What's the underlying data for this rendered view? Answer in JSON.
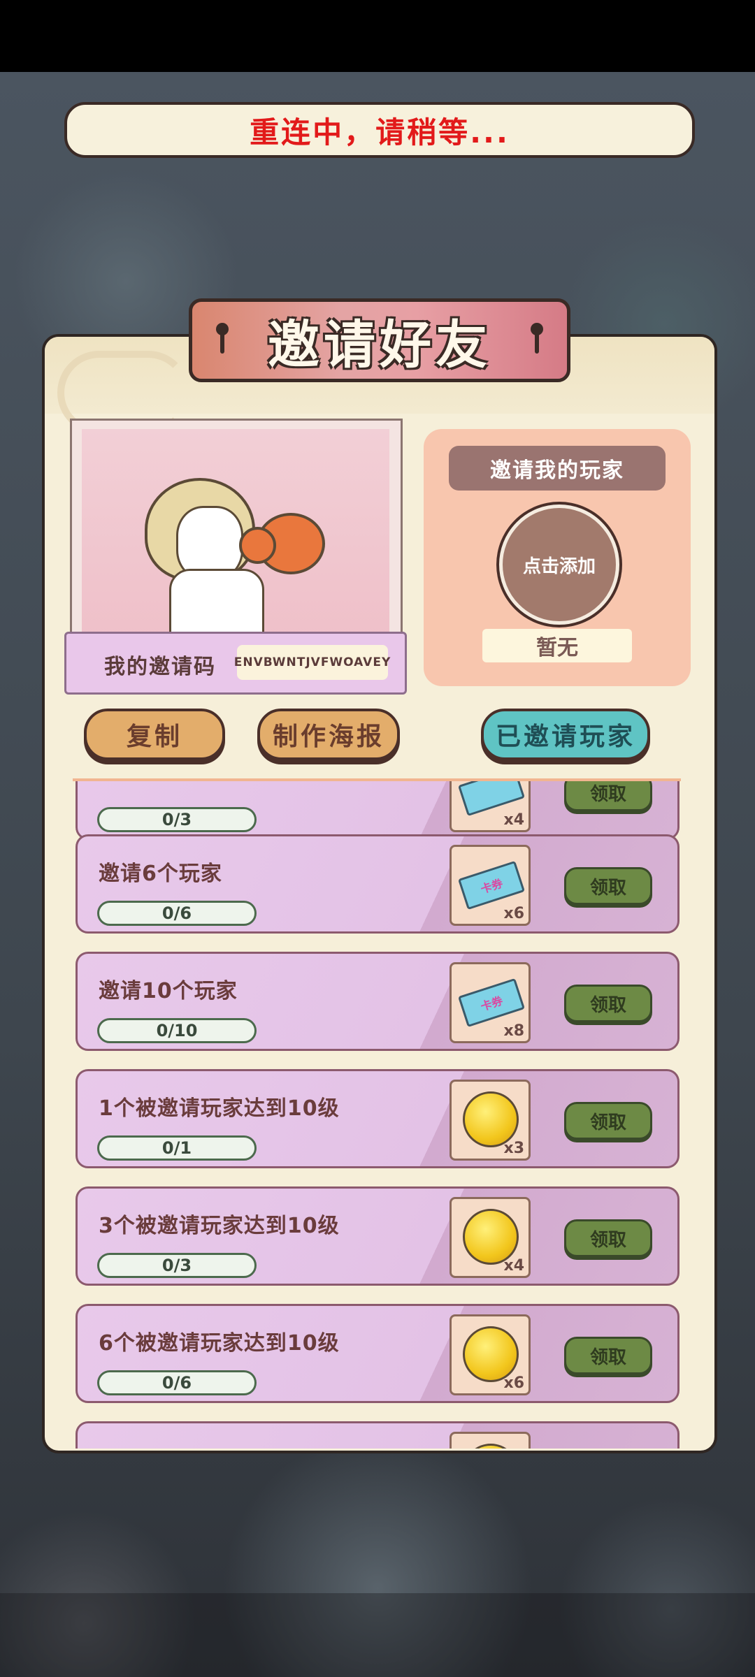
{
  "reconnect": {
    "text": "重连中，请稍等..."
  },
  "dialog": {
    "title": "邀请好友",
    "invite_code_label": "我的邀请码",
    "invite_code": "ENVBWNTJVFWOAVEY",
    "inviter": {
      "title": "邀请我的玩家",
      "add_label": "点击添加",
      "none_label": "暂无"
    },
    "buttons": {
      "copy": "复制",
      "poster": "制作海报",
      "invited_players": "已邀请玩家"
    }
  },
  "tasks": [
    {
      "title": "",
      "progress": "0/3",
      "reward_icon": "ticket-icon",
      "reward_count": "x4",
      "claim_label": "领取"
    },
    {
      "title": "邀请6个玩家",
      "progress": "0/6",
      "reward_icon": "ticket-icon",
      "reward_label": "卡券",
      "reward_count": "x6",
      "claim_label": "领取"
    },
    {
      "title": "邀请10个玩家",
      "progress": "0/10",
      "reward_icon": "ticket-icon",
      "reward_label": "卡券",
      "reward_count": "x8",
      "claim_label": "领取"
    },
    {
      "title": "1个被邀请玩家达到10级",
      "progress": "0/1",
      "reward_icon": "coin-icon",
      "reward_count": "x3",
      "claim_label": "领取"
    },
    {
      "title": "3个被邀请玩家达到10级",
      "progress": "0/3",
      "reward_icon": "coin-icon",
      "reward_count": "x4",
      "claim_label": "领取"
    },
    {
      "title": "6个被邀请玩家达到10级",
      "progress": "0/6",
      "reward_icon": "coin-icon",
      "reward_count": "x6",
      "claim_label": "领取"
    },
    {
      "title": "",
      "progress": "",
      "reward_icon": "coin-icon",
      "reward_count": "",
      "claim_label": ""
    }
  ],
  "colors": {
    "reconnect_text": "#e21a1a",
    "panel_bg": "#f6efd9",
    "task_bg": "#e8c9ea",
    "claim_button": "#6d8a45",
    "teal_button": "#5fc4c4",
    "orange_button": "#e3ad6b"
  }
}
